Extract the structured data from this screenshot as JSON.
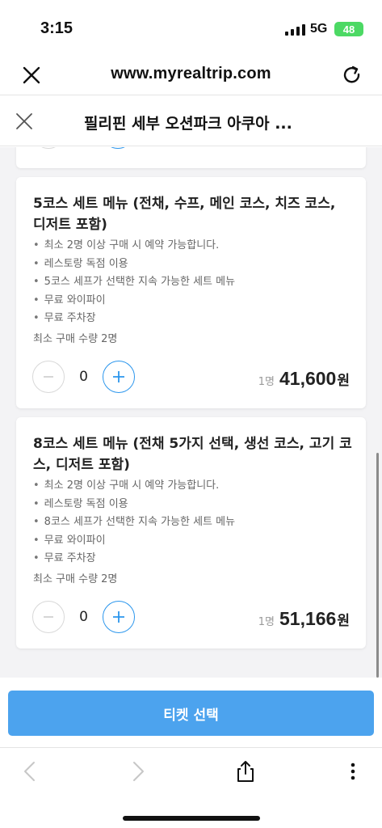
{
  "status_bar": {
    "time": "3:15",
    "network": "5G",
    "battery": "48"
  },
  "browser": {
    "url": "www.myrealtrip.com",
    "close_icon": "close-icon",
    "reload_icon": "reload-icon"
  },
  "page": {
    "title": "필리핀 세부 오션파크 아쿠아 ..."
  },
  "options": [
    {
      "name": "5코스 세트 메뉴 (전채, 수프, 메인 코스, 치즈 코스, 디저트 포함)",
      "features": [
        "최소 2명 이상 구매 시 예약 가능합니다.",
        "레스토랑 독점 이용",
        "5코스 세프가 선택한 지속 가능한 세트 메뉴",
        "무료 와이파이",
        "무료 주차장"
      ],
      "min_purchase": "최소 구매 수량 2명",
      "quantity": "0",
      "per_label": "1명",
      "price": "41,600",
      "currency": "원"
    },
    {
      "name": "8코스 세트 메뉴 (전채 5가지 선택, 생선 코스, 고기 코스, 디저트 포함)",
      "features": [
        "최소 2명 이상 구매 시 예약 가능합니다.",
        "레스토랑 독점 이용",
        "8코스 세프가 선택한 지속 가능한 세트 메뉴",
        "무료 와이파이",
        "무료 주차장"
      ],
      "min_purchase": "최소 구매 수량 2명",
      "quantity": "0",
      "per_label": "1명",
      "price": "51,166",
      "currency": "원"
    }
  ],
  "cta": {
    "label": "티켓 선택",
    "color": "#4ca3ee"
  },
  "toolbar": {
    "icons": [
      "back-icon",
      "forward-icon",
      "share-icon",
      "more-icon"
    ]
  }
}
